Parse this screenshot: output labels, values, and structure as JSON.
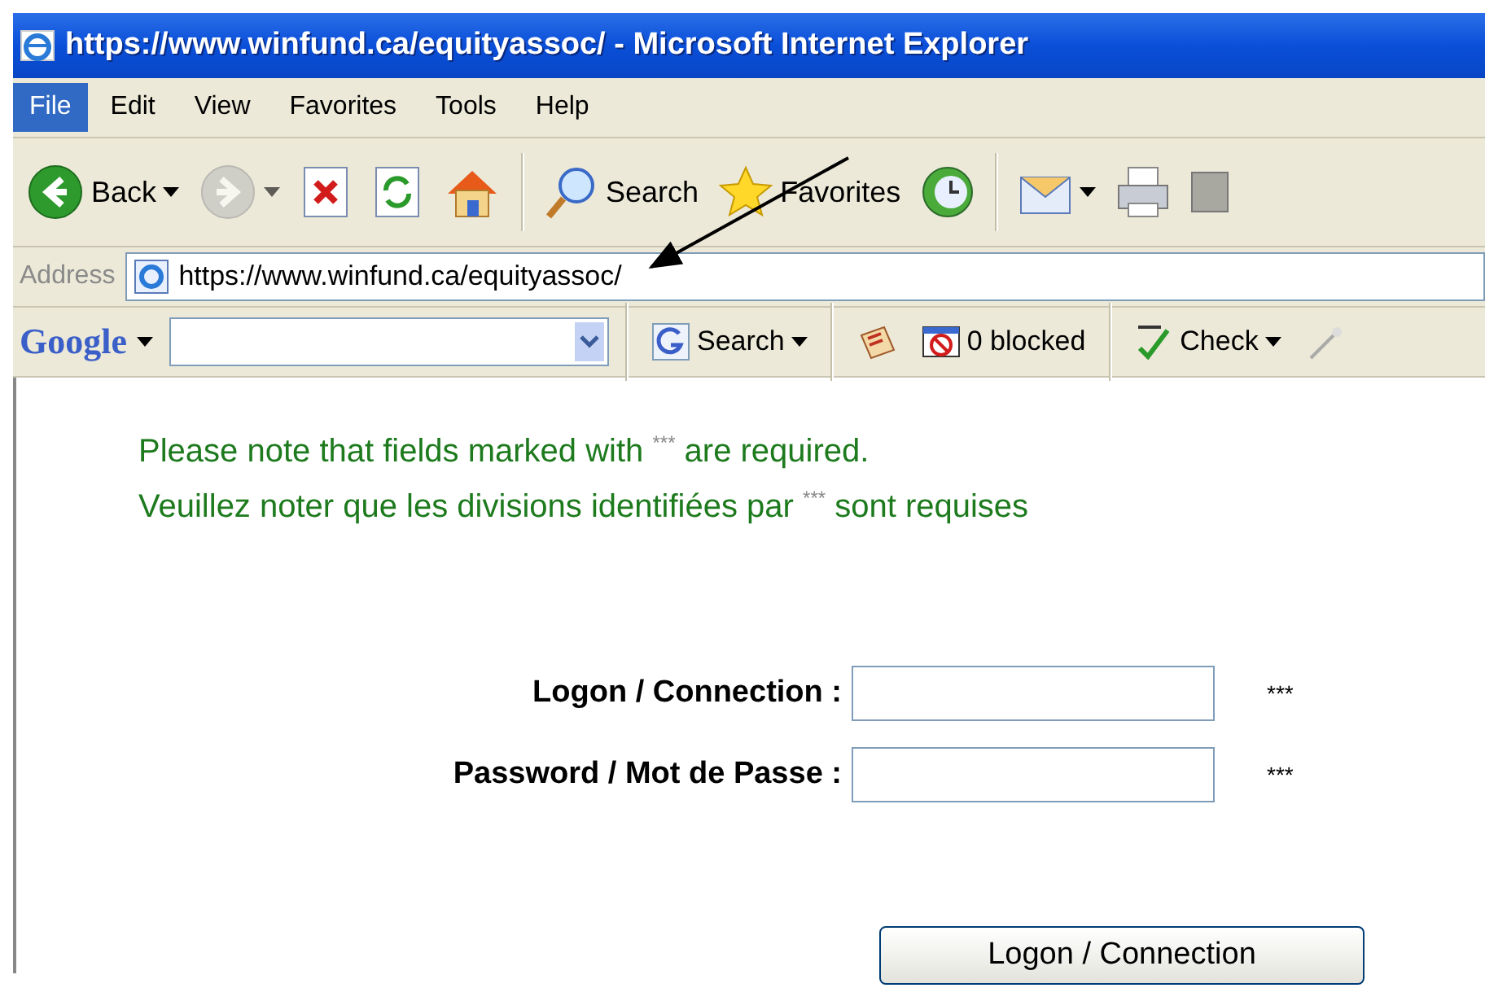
{
  "window": {
    "title": "https://www.winfund.ca/equityassoc/ - Microsoft Internet Explorer"
  },
  "menu": [
    {
      "label": "File",
      "selected": true
    },
    {
      "label": "Edit",
      "selected": false
    },
    {
      "label": "View",
      "selected": false
    },
    {
      "label": "Favorites",
      "selected": false
    },
    {
      "label": "Tools",
      "selected": false
    },
    {
      "label": "Help",
      "selected": false
    }
  ],
  "toolbar": [
    {
      "kind": "back",
      "label": "Back",
      "dropdown": true,
      "disabled": false
    },
    {
      "kind": "forward",
      "dropdown": true,
      "disabled": true
    },
    {
      "kind": "stop",
      "disabled": false
    },
    {
      "kind": "refresh",
      "disabled": false
    },
    {
      "kind": "home",
      "disabled": false
    },
    {
      "kind": "separator"
    },
    {
      "kind": "search",
      "label": "Search",
      "disabled": false
    },
    {
      "kind": "favorites",
      "label": "Favorites",
      "disabled": false
    },
    {
      "kind": "history",
      "disabled": false
    },
    {
      "kind": "separator"
    },
    {
      "kind": "mail",
      "dropdown": true,
      "disabled": false
    },
    {
      "kind": "print",
      "disabled": false
    },
    {
      "kind": "edit",
      "disabled": false
    }
  ],
  "address": {
    "label": "Address",
    "value": "https://www.winfund.ca/equityassoc/"
  },
  "google_bar": {
    "logo": "Google",
    "items": [
      {
        "kind": "gsearch",
        "label": "Search",
        "dropdown": true
      },
      {
        "kind": "separator"
      },
      {
        "kind": "news"
      },
      {
        "kind": "blocker",
        "label": "0 blocked"
      },
      {
        "kind": "separator"
      },
      {
        "kind": "spell",
        "label": "Check",
        "dropdown": true
      },
      {
        "kind": "wand"
      }
    ]
  },
  "page": {
    "notes": [
      "Please note that fields marked with $^{***}$ are required.",
      "Veuillez noter que les divisions identifiées par $^{***}$ sont requises"
    ],
    "fields": [
      {
        "label": "Logon / Connection :",
        "required": "***"
      },
      {
        "label": "Password / Mot de Passe :",
        "required": "***"
      }
    ],
    "button": "Logon / Connection"
  }
}
